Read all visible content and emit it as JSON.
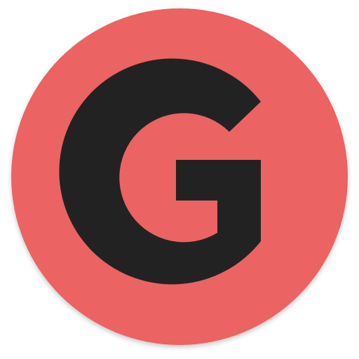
{
  "logo": {
    "letter": "G",
    "name": "g-letter-logo",
    "colors": {
      "circle": "#EB6363",
      "letter": "#222222",
      "background": "#FFFFFF"
    }
  }
}
